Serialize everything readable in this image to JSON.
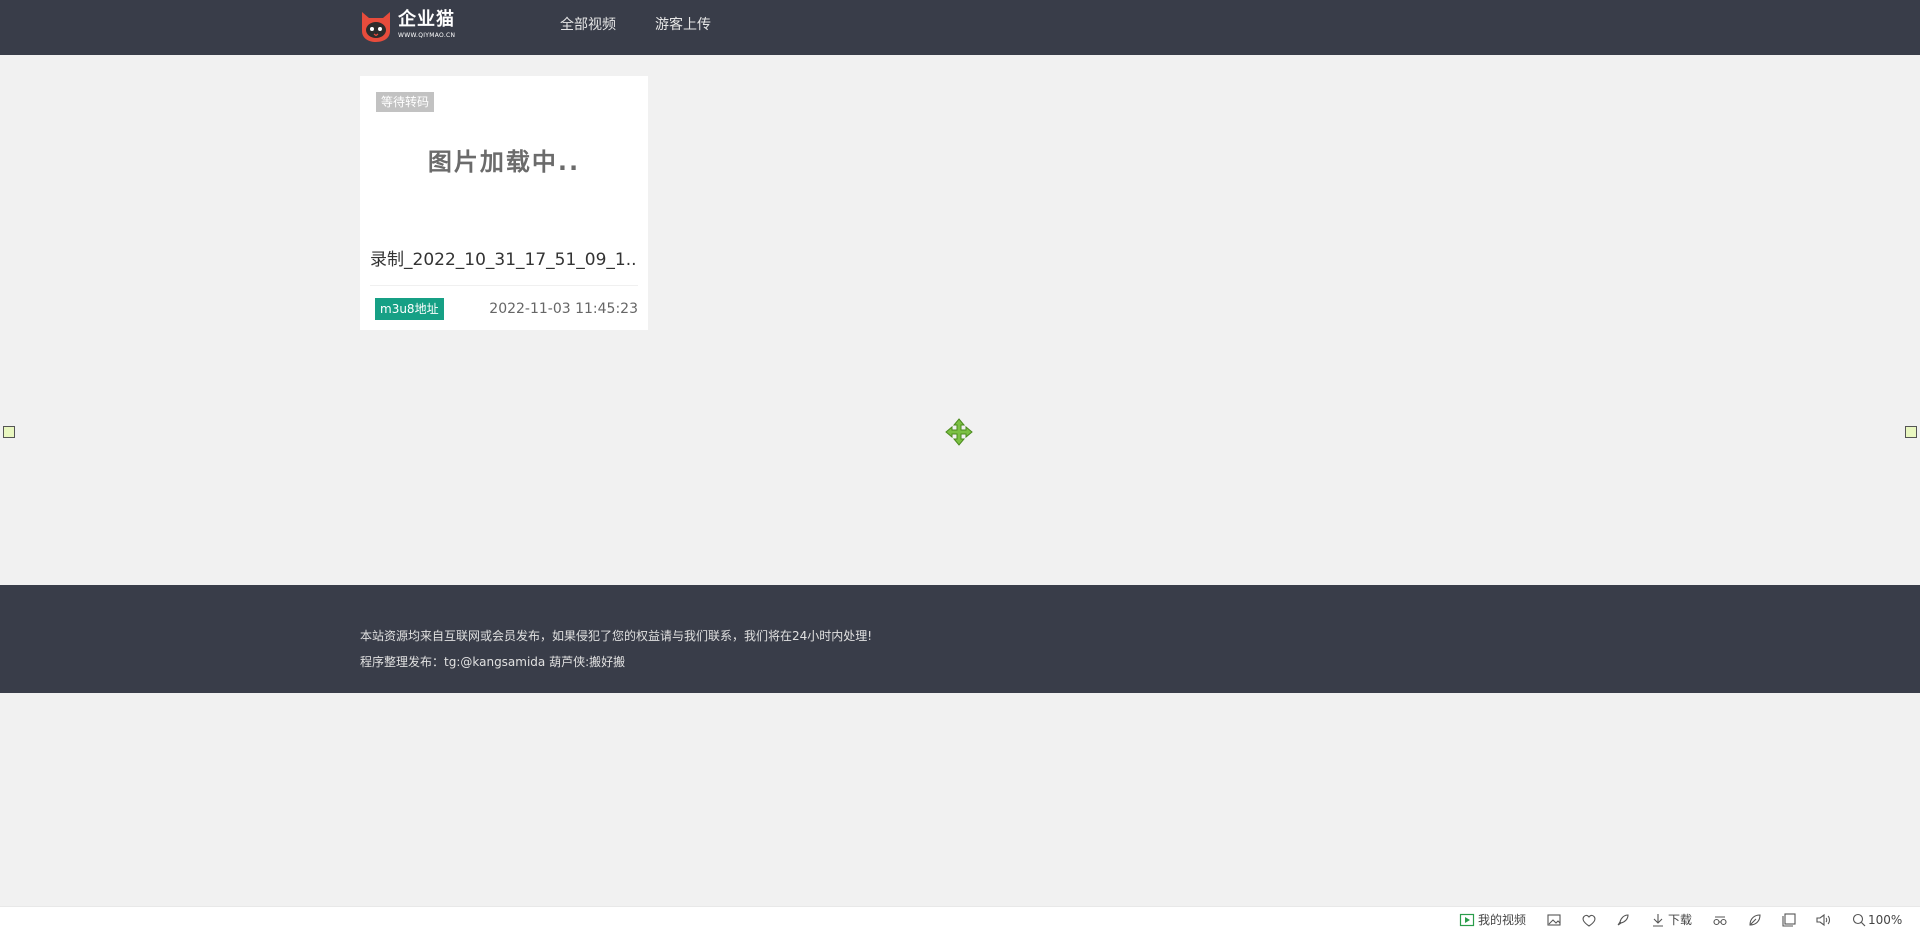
{
  "header": {
    "logo_text": "企业猫",
    "logo_sub": "WWW.QIYMAO.CN",
    "nav": {
      "all_videos": "全部视频",
      "guest_upload": "游客上传"
    }
  },
  "video_card": {
    "status_badge": "等待转码",
    "thumbnail_text": "图片加载中..",
    "title": "录制_2022_10_31_17_51_09_1...",
    "m3u8_label": "m3u8地址",
    "date": "2022-11-03 11:45:23"
  },
  "footer": {
    "line1": "本站资源均来自互联网或会员发布，如果侵犯了您的权益请与我们联系，我们将在24小时内处理!",
    "line2": "程序整理发布：tg:@kangsamida 葫芦侠:搬好搬"
  },
  "browser_status": {
    "my_video": "我的视频",
    "download": "下载",
    "zoom": "100%"
  },
  "colors": {
    "header_bg": "#393d49",
    "page_bg": "#f1f1f1",
    "accent_green": "#16a085",
    "badge_gray": "#c2c2c2"
  },
  "icons": {
    "logo": "cat-logo-icon",
    "move_cursor": "move-arrows-icon",
    "status_bar": [
      "play-icon",
      "image-icon",
      "heart-icon",
      "rocket-icon",
      "download-icon",
      "glasses-icon",
      "leaf-icon",
      "window-icon",
      "speaker-icon",
      "search-icon"
    ]
  }
}
